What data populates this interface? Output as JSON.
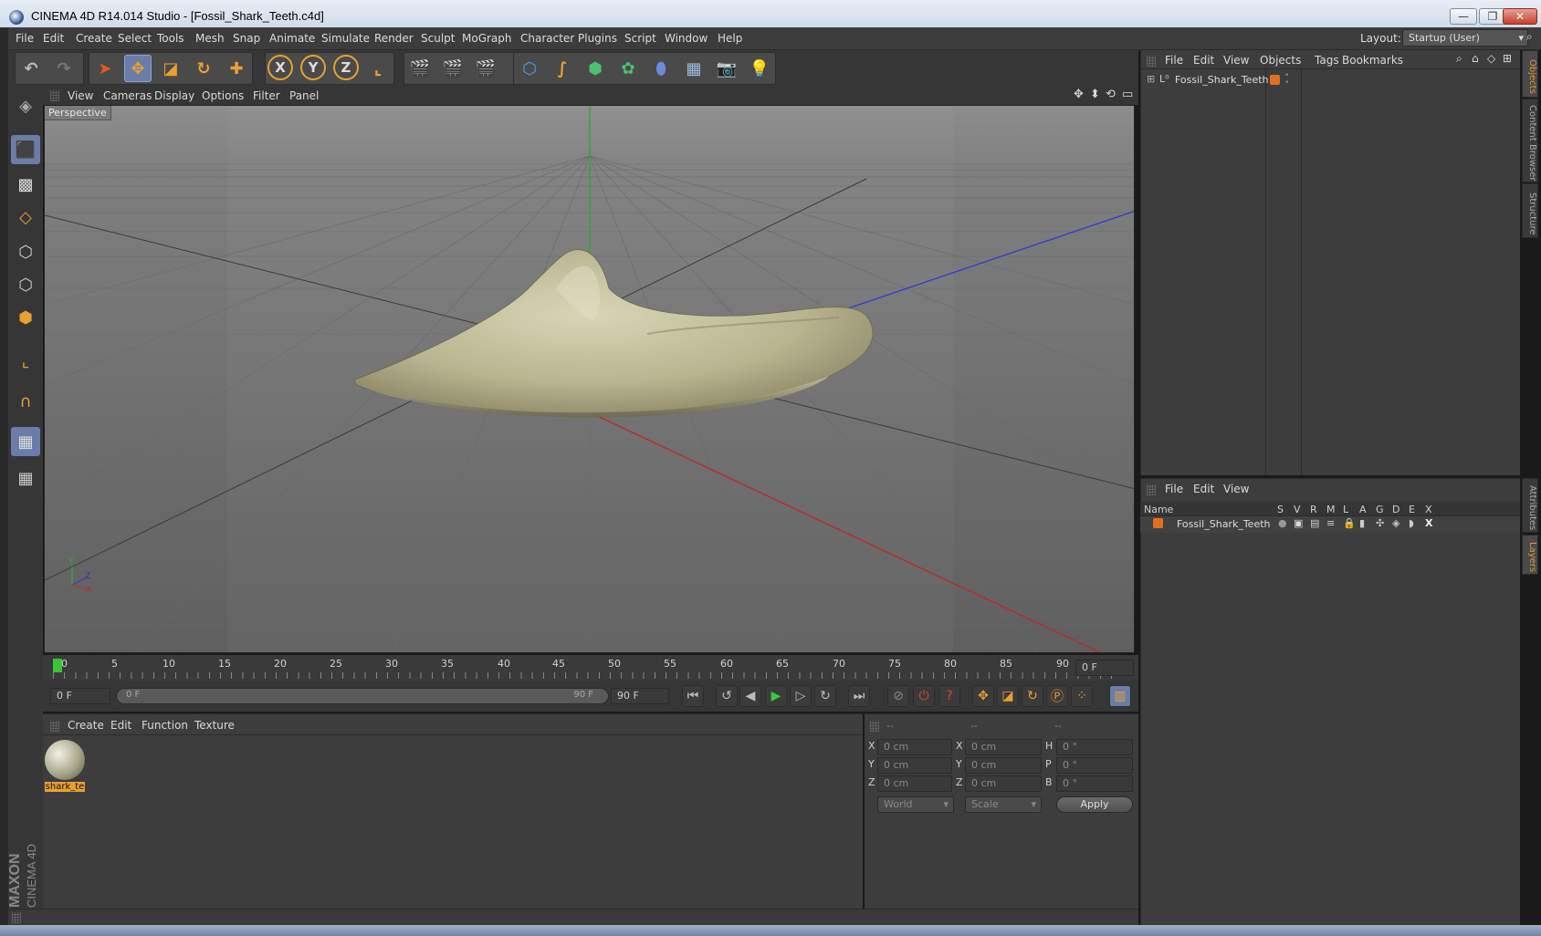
{
  "window": {
    "title": "CINEMA 4D R14.014 Studio - [Fossil_Shark_Teeth.c4d]",
    "min": "—",
    "restore": "❐",
    "close": "✕"
  },
  "menu": [
    "File",
    "Edit",
    "Create",
    "Select",
    "Tools",
    "Mesh",
    "Snap",
    "Animate",
    "Simulate",
    "Render",
    "Sculpt",
    "MoGraph",
    "Character",
    "Plugins",
    "Script",
    "Window",
    "Help"
  ],
  "layout": {
    "label": "Layout:",
    "value": "Startup (User)"
  },
  "viewport": {
    "menu": [
      "View",
      "Cameras",
      "Display",
      "Options",
      "Filter",
      "Panel"
    ],
    "label": "Perspective",
    "axis": {
      "y": "Y",
      "z": "Z",
      "x": "X"
    }
  },
  "timeline": {
    "ticks": [
      "0",
      "5",
      "10",
      "15",
      "20",
      "25",
      "30",
      "35",
      "40",
      "45",
      "50",
      "55",
      "60",
      "65",
      "70",
      "75",
      "80",
      "85",
      "90"
    ],
    "current_frame": "0 F",
    "start": "0 F",
    "range_start": "0 F",
    "range_end": "90 F",
    "end": "90 F"
  },
  "material_manager": {
    "menu": [
      "Create",
      "Edit",
      "Function",
      "Texture"
    ],
    "materials": [
      {
        "name": "shark_te"
      }
    ]
  },
  "coordinates": {
    "headers": [
      "--",
      "--",
      "--"
    ],
    "rows": [
      {
        "a": "X",
        "av": "0 cm",
        "b": "X",
        "bv": "0 cm",
        "c": "H",
        "cv": "0 °"
      },
      {
        "a": "Y",
        "av": "0 cm",
        "b": "Y",
        "bv": "0 cm",
        "c": "P",
        "cv": "0 °"
      },
      {
        "a": "Z",
        "av": "0 cm",
        "b": "Z",
        "bv": "0 cm",
        "c": "B",
        "cv": "0 °"
      }
    ],
    "mode1": "World",
    "mode2": "Scale",
    "apply": "Apply"
  },
  "object_manager": {
    "menu": [
      "File",
      "Edit",
      "View",
      "Objects",
      "Tags",
      "Bookmarks"
    ],
    "objects": [
      {
        "name": "Fossil_Shark_Teeth"
      }
    ]
  },
  "layer_manager": {
    "menu": [
      "File",
      "Edit",
      "View"
    ],
    "columns": [
      "Name",
      "S",
      "V",
      "R",
      "M",
      "L",
      "A",
      "G",
      "D",
      "E",
      "X"
    ],
    "layers": [
      {
        "name": "Fossil_Shark_Teeth"
      }
    ]
  },
  "side_tabs": {
    "top": [
      "Objects",
      "Content Browser",
      "Structure"
    ],
    "bottom": [
      "Attributes",
      "Layers"
    ]
  },
  "brand": {
    "maker": "MAXON",
    "product": "CINEMA 4D"
  },
  "colors": {
    "accent": "#e8a030",
    "layer_orange": "#e07020",
    "axis_x": "#c03030",
    "axis_y": "#30b030",
    "axis_z": "#3040c0"
  }
}
